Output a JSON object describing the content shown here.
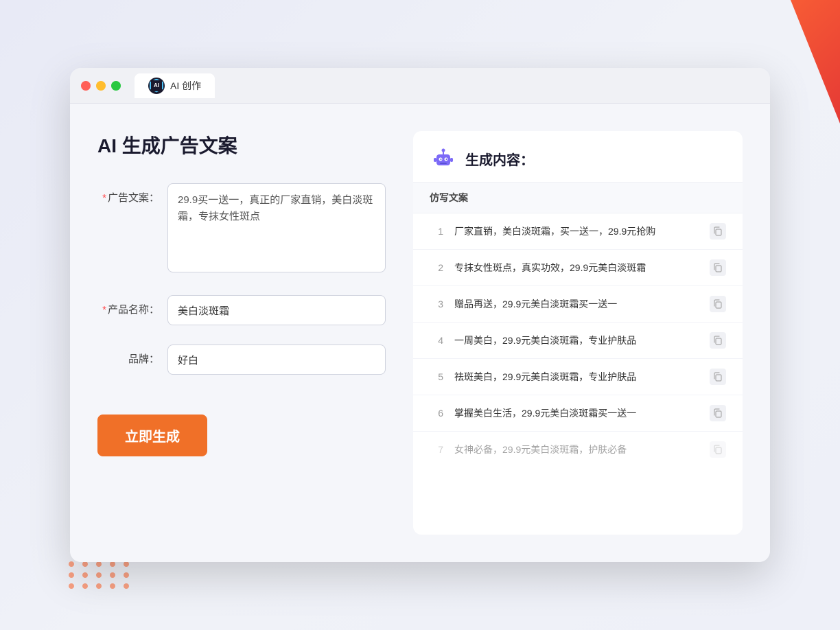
{
  "window": {
    "tab_label": "AI 创作",
    "controls": {
      "close": "close",
      "minimize": "minimize",
      "maximize": "maximize"
    }
  },
  "left_panel": {
    "title": "AI 生成广告文案",
    "form": {
      "ad_copy_label": "广告文案：",
      "ad_copy_required": "*",
      "ad_copy_value": "29.9买一送一，真正的厂家直销，美白淡斑霜，专抹女性斑点",
      "product_name_label": "产品名称：",
      "product_name_required": "*",
      "product_name_value": "美白淡斑霜",
      "brand_label": "品牌：",
      "brand_value": "好白"
    },
    "generate_button": "立即生成"
  },
  "right_panel": {
    "header_title": "生成内容：",
    "table_header": "仿写文案",
    "results": [
      {
        "num": "1",
        "text": "厂家直销，美白淡斑霜，买一送一，29.9元抢购"
      },
      {
        "num": "2",
        "text": "专抹女性斑点，真实功效，29.9元美白淡斑霜"
      },
      {
        "num": "3",
        "text": "赠品再送，29.9元美白淡斑霜买一送一"
      },
      {
        "num": "4",
        "text": "一周美白，29.9元美白淡斑霜，专业护肤品"
      },
      {
        "num": "5",
        "text": "祛斑美白，29.9元美白淡斑霜，专业护肤品"
      },
      {
        "num": "6",
        "text": "掌握美白生活，29.9元美白淡斑霜买一送一"
      },
      {
        "num": "7",
        "text": "女神必备，29.9元美白淡斑霜，护肤必备",
        "dimmed": true
      }
    ]
  }
}
